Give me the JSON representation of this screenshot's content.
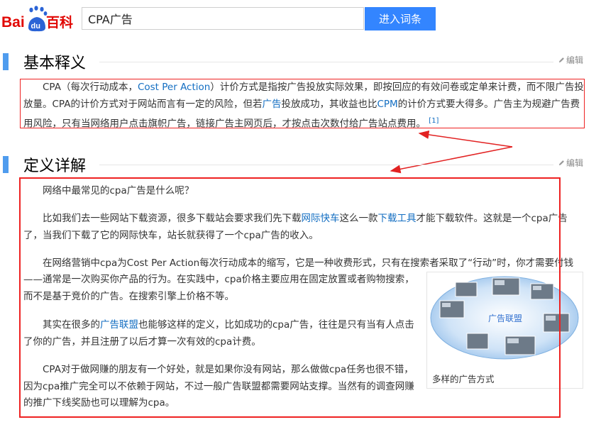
{
  "header": {
    "logo_text_red": "Bai",
    "logo_text_paw": "du",
    "logo_text_baike": "百科",
    "search_value": "CPA广告",
    "search_button": "进入词条"
  },
  "section1": {
    "title": "基本释义",
    "edit_label": "编辑",
    "para": {
      "t1": "CPA（每次行动成本，",
      "l1": "Cost Per Action",
      "t2": "）计价方式是指按广告投放实际效果，即按回应的有效问卷或定单来计费，而不限广告投放量。CPA的计价方式对于网站而言有一定的风险，但若",
      "l2": "广告",
      "t3": "投放成功，其收益也比",
      "l3": "CPM",
      "t4": "的计价方式要大得多。广告主为规避广告费用风险，只有当网络用户点击旗帜广告，链接广告主网页后，才按点击次数付给广告站点费用。",
      "ref": "[1]"
    }
  },
  "section2": {
    "title": "定义详解",
    "edit_label": "编辑",
    "p1": "网络中最常见的cpa广告是什么呢？",
    "p2": {
      "t1": "比如我们去一些网站下载资源，很多下载站会要求我们先下载",
      "l1": "网际快车",
      "t2": "这么一款",
      "l2": "下载工具",
      "t3": "才能下载软件。这就是一个cpa广告了，当我们下载了它的网际快车，站长就获得了一个cpa广告的收入。"
    },
    "p3": {
      "line1": "在网络营销中cpa为Cost Per Action每次行动成本的缩写，它是一种收费形式，只有在搜索者采取了“行动”时，你才需要付钱",
      "rest": "——通常是一次购买你产品的行为。在实践中，cpa价格主要应用在固定放置或者购物搜索，而不是基于竞价的广告。在搜索引擎上价格不等。"
    },
    "p4": {
      "t1": "其实在很多的",
      "l1": "广告联盟",
      "t2": "也能够这样的定义，比如成功的cpa广告，往往是只有当有人点击了你的广告，并且注册了以后才算一次有效的cpa计费。"
    },
    "p5": "CPA对于做网赚的朋友有一个好处，就是如果你没有网站，那么做做cpa任务也很不错，因为cpa推广完全可以不依赖于网站，不过一般广告联盟都需要网站支撑。当然有的调查网赚的推广下线奖励也可以理解为cpa。",
    "figure": {
      "center_label": "广告联盟",
      "caption": "多样的广告方式"
    }
  },
  "colors": {
    "accent_blue": "#3385ff",
    "section_bar": "#4f9cee",
    "link": "#136ec2",
    "annotation_red": "#e22222"
  }
}
